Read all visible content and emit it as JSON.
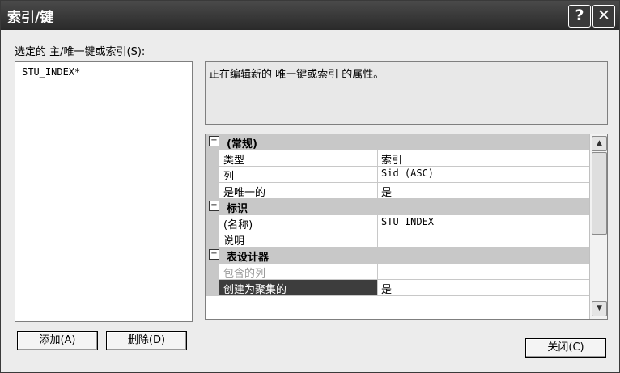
{
  "window": {
    "title": "索引/键",
    "help_label": "?",
    "close_label": "✕"
  },
  "left": {
    "label": "选定的 主/唯一键或索引(S):",
    "items": [
      "STU_INDEX*"
    ]
  },
  "description": "正在编辑新的 唯一键或索引 的属性。",
  "grid": {
    "toggle_glyph": "−",
    "scroll_up": "▲",
    "scroll_down": "▼",
    "dropdown": "▼",
    "categories": [
      {
        "label": "(常规)"
      },
      {
        "label": "标识"
      },
      {
        "label": "表设计器"
      }
    ],
    "rows": [
      {
        "name": "类型",
        "value": "索引"
      },
      {
        "name": "列",
        "value": "Sid (ASC)"
      },
      {
        "name": "是唯一的",
        "value": "是"
      },
      {
        "name": "(名称)",
        "value": "STU_INDEX"
      },
      {
        "name": "说明",
        "value": ""
      },
      {
        "name": "包含的列",
        "value": ""
      },
      {
        "name": "创建为聚集的",
        "value": "是"
      }
    ]
  },
  "buttons": {
    "add": "添加(A)",
    "delete": "删除(D)",
    "close": "关闭(C)"
  }
}
